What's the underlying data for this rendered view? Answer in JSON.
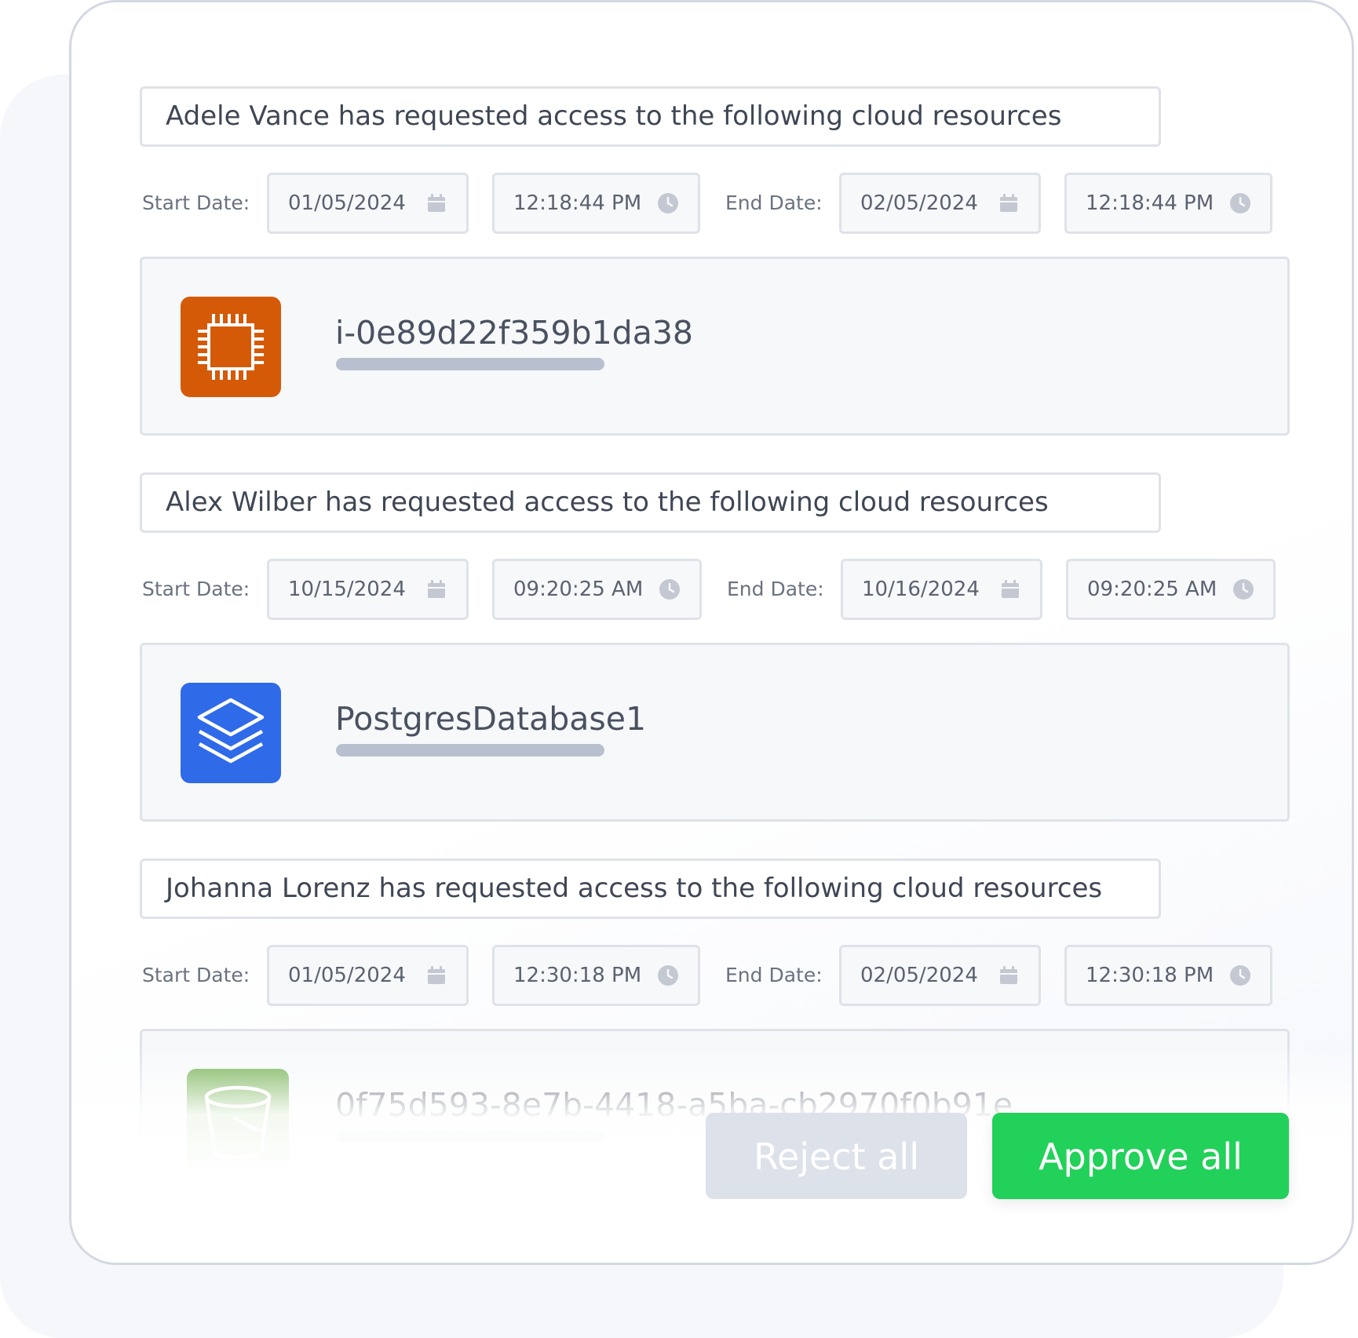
{
  "requests": [
    {
      "title": "Adele Vance has requested access to the following cloud resources",
      "start_label": "Start Date:",
      "start_date": "01/05/2024",
      "start_time": "12:18:44 PM",
      "end_label": "End Date:",
      "end_date": "02/05/2024",
      "end_time": "12:18:44 PM",
      "resource": {
        "name": "i-0e89d22f359b1da38",
        "icon": "chip-icon",
        "color": "#d45a08"
      }
    },
    {
      "title": "Alex Wilber has requested access to the following cloud resources",
      "start_label": "Start Date:",
      "start_date": "10/15/2024",
      "start_time": "09:20:25 AM",
      "end_label": "End Date:",
      "end_date": "10/16/2024",
      "end_time": "09:20:25 AM",
      "resource": {
        "name": "PostgresDatabase1",
        "icon": "layers-icon",
        "color": "#2f6ae8"
      }
    },
    {
      "title": "Johanna Lorenz has requested access to the following cloud resources",
      "start_label": "Start Date:",
      "start_date": "01/05/2024",
      "start_time": "12:30:18 PM",
      "end_label": "End Date:",
      "end_date": "02/05/2024",
      "end_time": "12:30:18 PM",
      "resource": {
        "name": "0f75d593-8e7b-4418-a5ba-cb2970f0b91e",
        "icon": "bucket-icon",
        "color": "#6fae4c"
      }
    }
  ],
  "actions": {
    "reject_label": "Reject all",
    "approve_label": "Approve all",
    "approve_color": "#22d159"
  }
}
